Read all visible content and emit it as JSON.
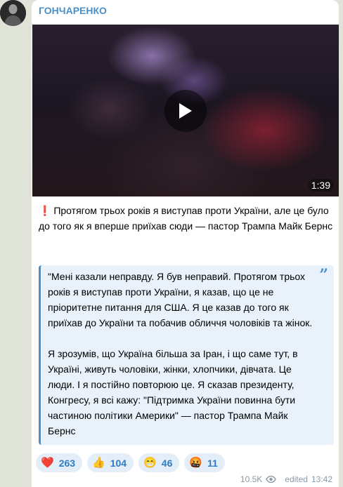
{
  "channel": {
    "name": "ГОНЧАРЕНКО",
    "accent": "#4a90c8"
  },
  "video": {
    "duration": "1:39",
    "play_icon": "play-icon"
  },
  "post": {
    "prefix_icon": "❗",
    "text": "Протягом трьох років я виступав проти України, але це було до того як я вперше приїхав сюди — пастор Трампа Майк Бернс"
  },
  "quote": {
    "paragraph1": "\"Мені казали неправду. Я був неправий. Протягом трьох років я виступав проти України, я казав, що це не пріоритетне питання для США. Я це казав до того як приїхав до України та побачив обличчя чоловіків та жінок.",
    "paragraph2": "Я зрозумів, що Україна більша за Іран, і що саме тут, в Україні, живуть чоловіки, жінки, хлопчики, дівчата. Це люди. І я постійно повторюю це. Я сказав президенту, Конгресу, я всі кажу: \"Підтримка України повинна бути частиною політики Америки\" — пастор Трампа Майк Бернс",
    "icon": "quote-icon"
  },
  "reactions": [
    {
      "emoji": "❤️",
      "count": "263"
    },
    {
      "emoji": "👍",
      "count": "104"
    },
    {
      "emoji": "😁",
      "count": "46"
    },
    {
      "emoji": "🤬",
      "count": "11"
    }
  ],
  "meta": {
    "views": "10.5K",
    "edited_label": "edited",
    "time": "13:42"
  }
}
